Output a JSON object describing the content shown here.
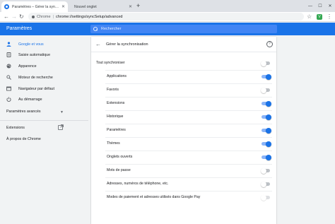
{
  "tabs": [
    {
      "title": "Paramètres – Gérer la synchronisation",
      "active": true
    },
    {
      "title": "Nouvel onglet",
      "active": false
    }
  ],
  "toolbar": {
    "site_label": "Chrome",
    "separator": "|",
    "url": "chrome://settings/syncSetup/advanced",
    "extension_badge": "V"
  },
  "header": {
    "title": "Paramètres",
    "search_placeholder": "Rechercher"
  },
  "sidebar": {
    "items": [
      {
        "label": "Google et vous",
        "icon": "person-icon",
        "active": true
      },
      {
        "label": "Saisie automatique",
        "icon": "assignment-icon",
        "active": false
      },
      {
        "label": "Apparence",
        "icon": "palette-icon",
        "active": false
      },
      {
        "label": "Moteur de recherche",
        "icon": "search-icon",
        "active": false
      },
      {
        "label": "Navigateur par défaut",
        "icon": "browser-icon",
        "active": false
      },
      {
        "label": "Au démarrage",
        "icon": "power-icon",
        "active": false
      }
    ],
    "advanced_label": "Paramètres avancés",
    "extensions_label": "Extensions",
    "about_label": "À propos de Chrome"
  },
  "sync": {
    "title": "Gérer la synchronisation",
    "master": {
      "label": "Tout synchroniser",
      "on": false
    },
    "items": [
      {
        "label": "Applications",
        "on": true
      },
      {
        "label": "Favoris",
        "on": false
      },
      {
        "label": "Extensions",
        "on": true
      },
      {
        "label": "Historique",
        "on": true
      },
      {
        "label": "Paramètres",
        "on": true
      },
      {
        "label": "Thèmes",
        "on": true
      },
      {
        "label": "Onglets ouverts",
        "on": true
      },
      {
        "label": "Mots de passe",
        "on": false
      },
      {
        "label": "Adresses, numéros de téléphone, etc.",
        "on": false
      },
      {
        "label": "Modes de paiement et adresses utilisés dans Google Pay",
        "on": false,
        "disabled": true
      }
    ]
  },
  "colors": {
    "accent": "#1a73e8",
    "toggle_on_track": "#8ab4f8",
    "toggle_off_track": "#bdc1c6"
  }
}
